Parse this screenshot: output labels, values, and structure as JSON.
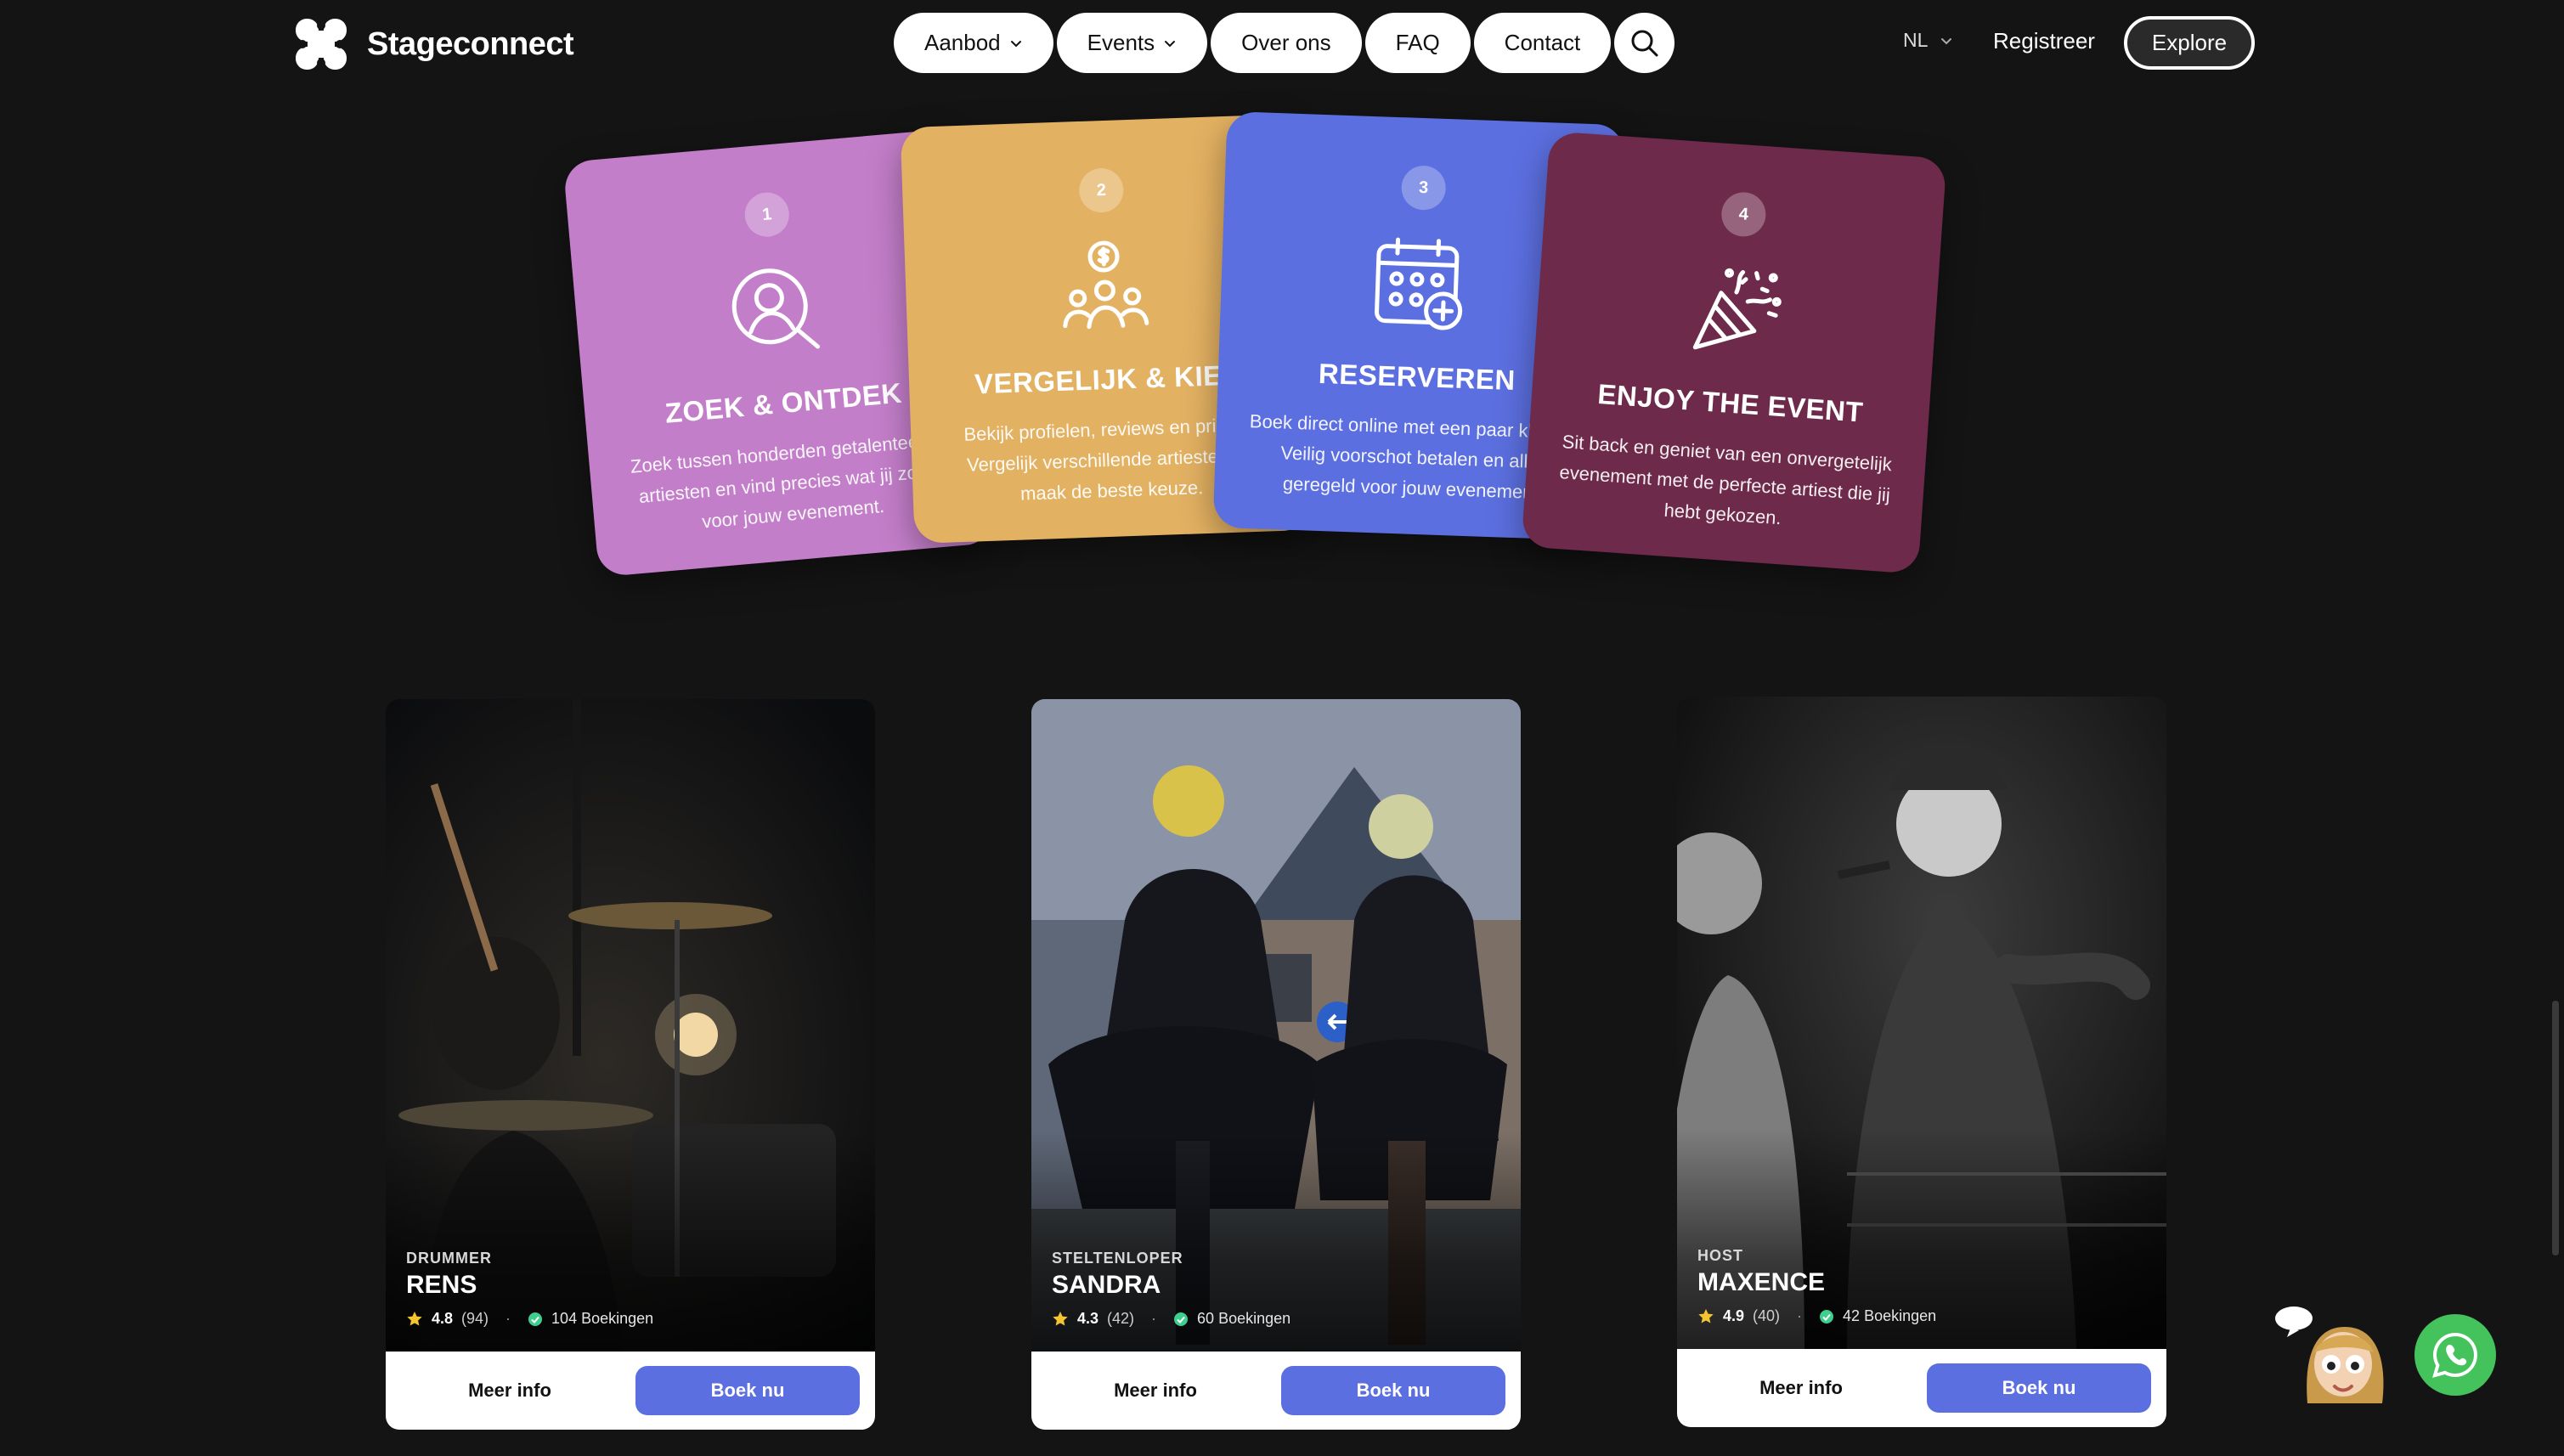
{
  "header": {
    "brand": "Stageconnect",
    "nav": [
      {
        "label": "Aanbod",
        "dropdown": true
      },
      {
        "label": "Events",
        "dropdown": true
      },
      {
        "label": "Over ons",
        "dropdown": false
      },
      {
        "label": "FAQ",
        "dropdown": false
      },
      {
        "label": "Contact",
        "dropdown": false
      }
    ],
    "language": "NL",
    "register_label": "Registreer",
    "explore_label": "Explore"
  },
  "steps": [
    {
      "number": "1",
      "title": "ZOEK & ONTDEK",
      "description": "Zoek tussen honderden getalenteerde artiesten en vind precies wat jij zoekt voor jouw evenement.",
      "icon": "user-search-icon",
      "color": "#c37ec9"
    },
    {
      "number": "2",
      "title": "VERGELIJK & KIES",
      "description": "Bekijk profielen, reviews en prijzen. Vergelijk verschillende artiesten en maak de beste keuze.",
      "icon": "people-money-icon",
      "color": "#e3b162"
    },
    {
      "number": "3",
      "title": "RESERVEREN",
      "description": "Boek direct online met een paar klikken. Veilig voorschot betalen en alles geregeld voor jouw evenement.",
      "icon": "calendar-add-icon",
      "color": "#5c6fe0"
    },
    {
      "number": "4",
      "title": "ENJOY THE EVENT",
      "description": "Sit back en geniet van een onvergetelijk evenement met de perfecte artiest die jij hebt gekozen.",
      "icon": "party-popper-icon",
      "color": "#6e2a4b"
    }
  ],
  "artists": [
    {
      "category": "DRUMMER",
      "name": "RENS",
      "rating": "4.8",
      "reviews": "(94)",
      "bookings": "104 Boekingen",
      "more_label": "Meer info",
      "book_label": "Boek nu"
    },
    {
      "category": "STELTENLOPER",
      "name": "SANDRA",
      "rating": "4.3",
      "reviews": "(42)",
      "bookings": "60 Boekingen",
      "more_label": "Meer info",
      "book_label": "Boek nu"
    },
    {
      "category": "HOST",
      "name": "MAXENCE",
      "rating": "4.9",
      "reviews": "(40)",
      "bookings": "42 Boekingen",
      "more_label": "Meer info",
      "book_label": "Boek nu"
    }
  ],
  "colors": {
    "background": "#141414",
    "accent": "#5c6fe0",
    "whatsapp": "#44c25c",
    "star": "#f5c531",
    "verified": "#3ecf8e"
  }
}
